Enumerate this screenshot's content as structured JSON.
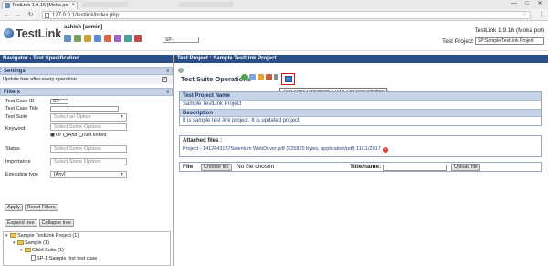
{
  "browser": {
    "tab_title": "TestLink 1.9.16 (Moka po",
    "tab_close": "×",
    "url": "127.0.0.1/testlink/index.php",
    "back": "←",
    "forward": "→",
    "reload": "↻",
    "star": "☆",
    "menu": "⋮",
    "win_min": "—",
    "win_max": "□",
    "win_close": "✕"
  },
  "header": {
    "logo_text": "TestLink",
    "user": "ashish [admin]",
    "project_search_value": "SP-",
    "version": "TestLink 1.9.16 (Moka pot)",
    "project_label": "Test Project",
    "project_selected": "SP:Sample TestLink Project"
  },
  "left": {
    "title": "Navigator - Test Specification",
    "settings_label": "Settings",
    "settings_option": "Update tree after every operation",
    "settings_check": "✓",
    "filters_label": "Filters",
    "collapse_glyph": "»",
    "fields": {
      "test_case_id_label": "Test Case ID",
      "test_case_id_value": "SP-",
      "test_case_title_label": "Test Case Title",
      "test_suite_label": "Test Suite",
      "test_suite_placeholder": "Select an Option",
      "keyword_label": "Keyword",
      "keyword_placeholder": "Select Some Options",
      "or_label": "Or",
      "and_label": "And",
      "not_linked_label": "Not linked",
      "status_label": "Status",
      "status_placeholder": "Select Some Options",
      "importance_label": "Importance",
      "importance_placeholder": "Select Some Options",
      "execution_type_label": "Execution type",
      "execution_type_value": "[Any]"
    },
    "apply_button": "Apply",
    "reset_button": "Reset Filters",
    "expand_button": "Expand tree",
    "collapse_button": "Collapse tree",
    "tree": [
      "Sample TestLink Project (1)",
      "Sample (1)",
      "Child Suite (1)",
      "SP-1:Sample first test case"
    ]
  },
  "right": {
    "title": "Test Project : Sample TestLink Project",
    "ops_title": "Test Suite Operations",
    "tooltip": "Test Spec Document (HTML) on new window",
    "project_name_label": "Test Project Name",
    "project_name_value": "Sample TestLink Project",
    "description_label": "Description",
    "description_value": "It is sample test link project. It is updated project",
    "attached_label": "Attached files :",
    "attached_value": "Project - 1412843157Selenium WebDriver.pdf (925825 bytes, application/pdf) 11/11/2017",
    "delete_glyph": "×",
    "file_label": "File",
    "choose_button": "Choose file",
    "no_file": "No file chosen",
    "title_name_label": "Title/name:",
    "upload_button": "Upload file"
  },
  "colors": {
    "nav_title_bg": "#2a4f86",
    "section_bg": "#c7d3e7",
    "highlight": "#d01818"
  }
}
